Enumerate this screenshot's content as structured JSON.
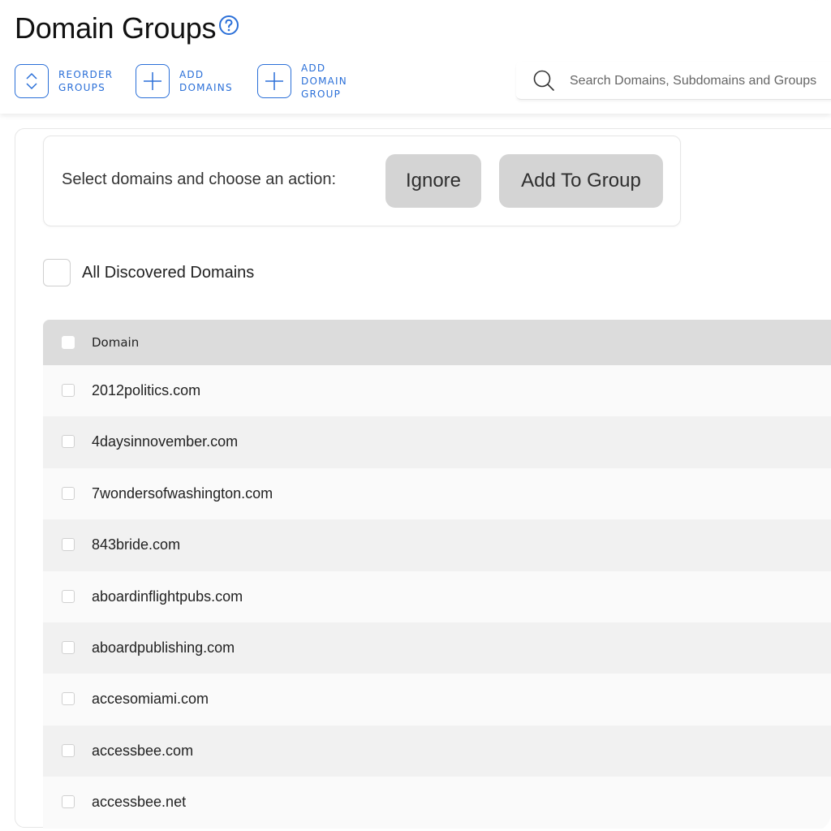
{
  "header": {
    "title": "Domain Groups",
    "toolbar": [
      {
        "id": "reorder",
        "lines": [
          "REORDER",
          "GROUPS"
        ],
        "icon": "reorder-icon"
      },
      {
        "id": "add-domains",
        "lines": [
          "ADD",
          "DOMAINS"
        ],
        "icon": "plus-icon"
      },
      {
        "id": "add-group",
        "lines": [
          "ADD",
          "DOMAIN",
          "GROUP"
        ],
        "icon": "plus-icon"
      }
    ],
    "search": {
      "placeholder": "Search Domains, Subdomains and Groups",
      "value": ""
    }
  },
  "actions": {
    "prompt": "Select domains and choose an action:",
    "ignore_label": "Ignore",
    "add_to_group_label": "Add To Group"
  },
  "all_domains": {
    "label": "All Discovered Domains",
    "checked": false
  },
  "table": {
    "column_header": "Domain",
    "rows": [
      "2012politics.com",
      "4daysinnovember.com",
      "7wondersofwashington.com",
      "843bride.com",
      "aboardinflightpubs.com",
      "aboardpublishing.com",
      "accesomiami.com",
      "accessbee.com",
      "accessbee.net"
    ]
  },
  "colors": {
    "accent": "#2a6fd8",
    "button_bg": "#d4d4d4",
    "header_row": "#dcdcdc"
  }
}
